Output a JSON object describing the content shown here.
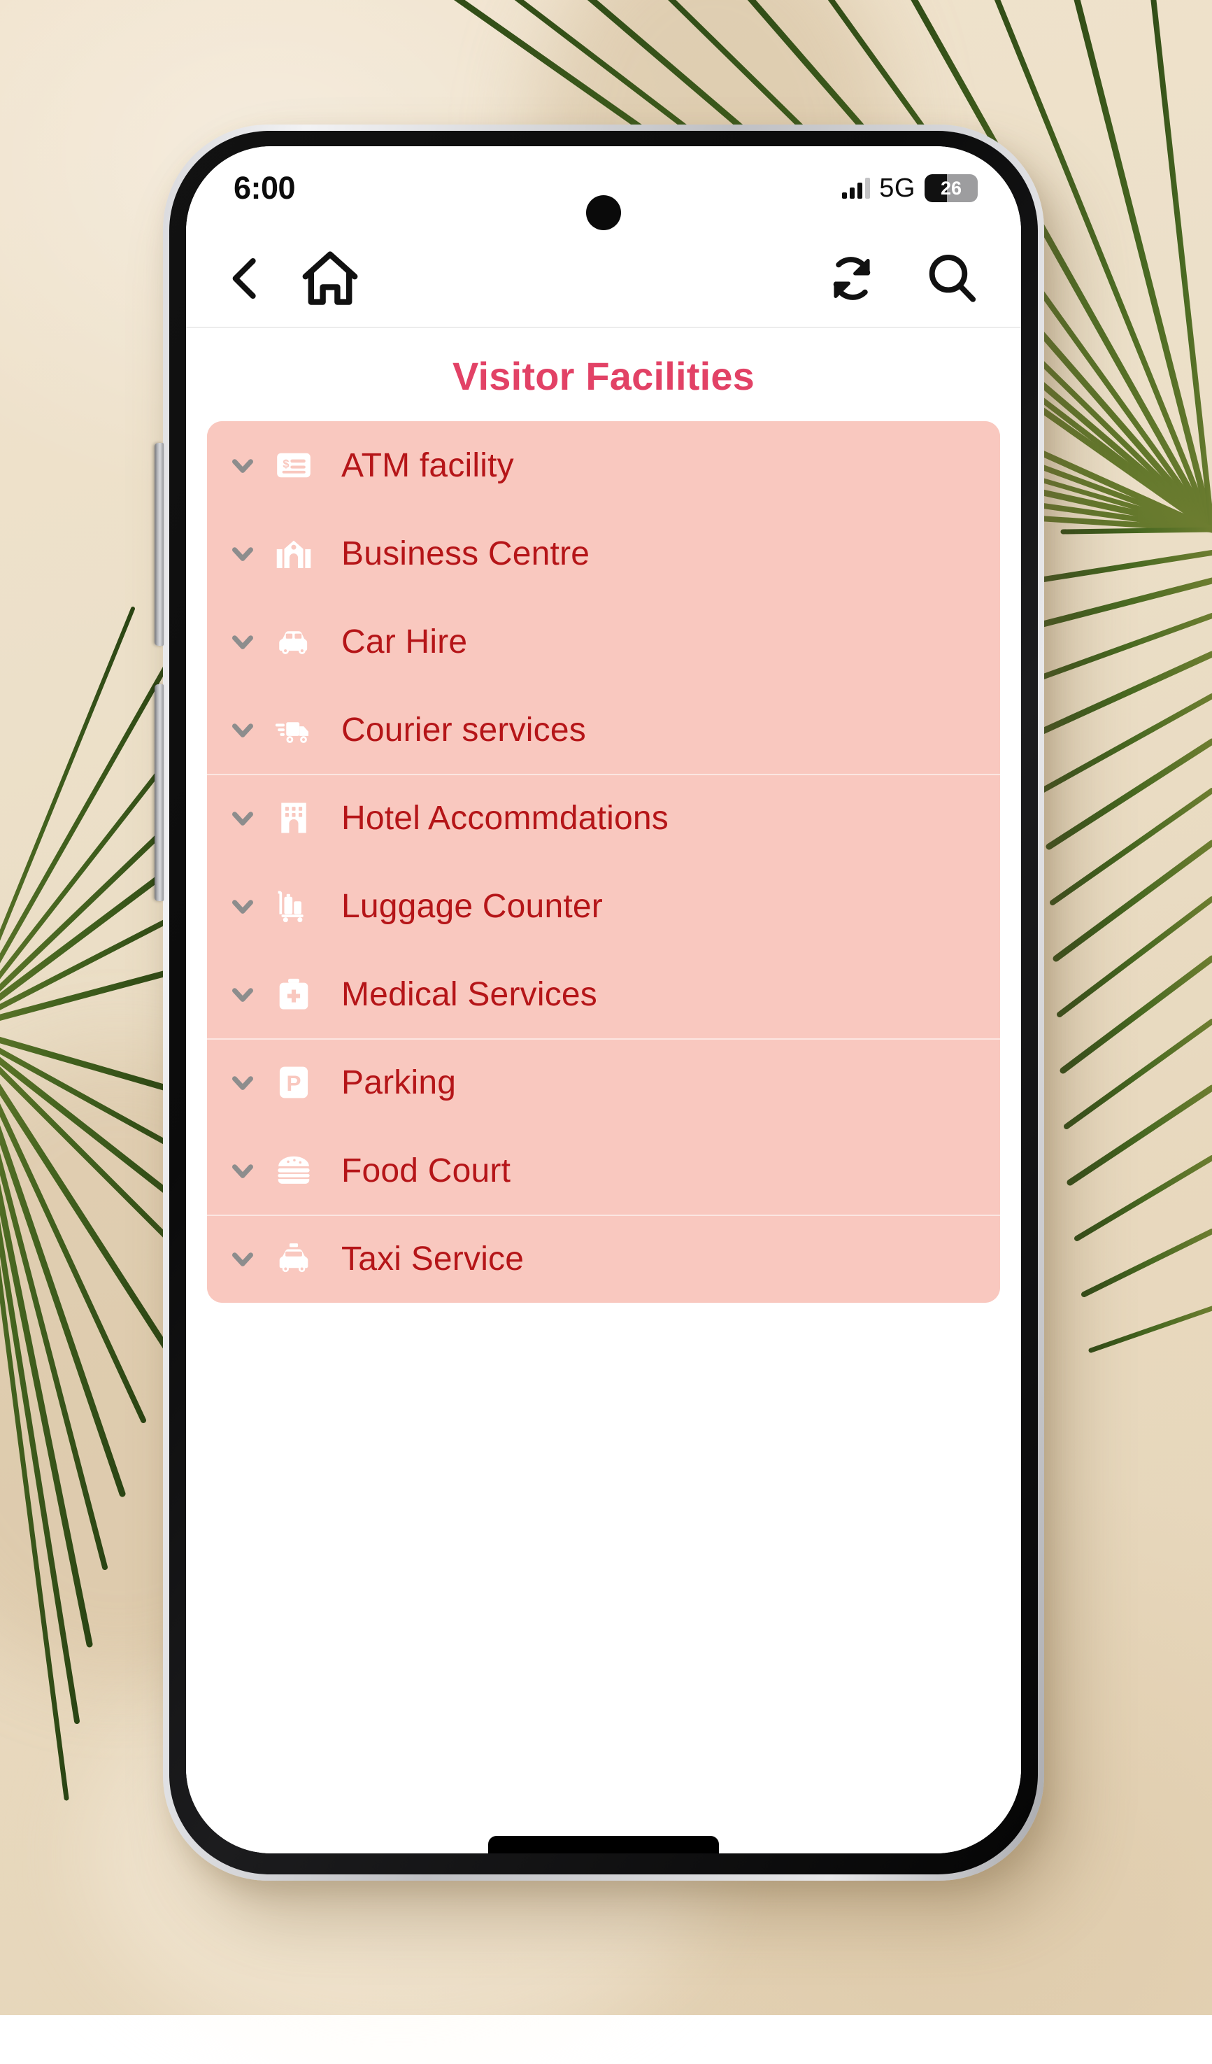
{
  "wallpaper": {
    "description": "beige wall with palm frond shadows",
    "base_color": "#e8d9bf",
    "frond_color": "#3f5a20"
  },
  "statusbar": {
    "time": "6:00",
    "signal_icon": "cellular-signal-icon",
    "signal_bars_filled": 3,
    "signal_bars_total": 4,
    "network": "5G",
    "battery_icon": "battery-icon",
    "battery_percent": "26"
  },
  "navbar": {
    "back_icon": "chevron-left-icon",
    "home_icon": "home-icon",
    "refresh_icon": "refresh-icon",
    "search_icon": "search-icon"
  },
  "header": {
    "title": "Visitor Facilities",
    "title_color": "#e24266"
  },
  "list": {
    "background_color": "#f9c8bf",
    "label_color": "#b51518",
    "chevron_color": "#8d8d8d",
    "icon_color": "#ffffff",
    "items": [
      {
        "label": "ATM facility",
        "icon": "atm-card-icon",
        "chevron": "chevron-down-icon",
        "group_start": true
      },
      {
        "label": "Business Centre",
        "icon": "business-building-icon",
        "chevron": "chevron-down-icon",
        "group_start": false
      },
      {
        "label": "Car Hire",
        "icon": "car-icon",
        "chevron": "chevron-down-icon",
        "group_start": false
      },
      {
        "label": "Courier services",
        "icon": "delivery-truck-icon",
        "chevron": "chevron-down-icon",
        "group_start": false
      },
      {
        "label": "Hotel Accommdations",
        "icon": "hotel-icon",
        "chevron": "chevron-down-icon",
        "group_start": true
      },
      {
        "label": "Luggage Counter",
        "icon": "luggage-cart-icon",
        "chevron": "chevron-down-icon",
        "group_start": false
      },
      {
        "label": "Medical Services",
        "icon": "medical-kit-icon",
        "chevron": "chevron-down-icon",
        "group_start": false
      },
      {
        "label": "Parking",
        "icon": "parking-sign-icon",
        "chevron": "chevron-down-icon",
        "group_start": true
      },
      {
        "label": "Food Court",
        "icon": "burger-icon",
        "chevron": "chevron-down-icon",
        "group_start": false
      },
      {
        "label": "Taxi Service",
        "icon": "taxi-icon",
        "chevron": "chevron-down-icon",
        "group_start": true
      }
    ]
  }
}
